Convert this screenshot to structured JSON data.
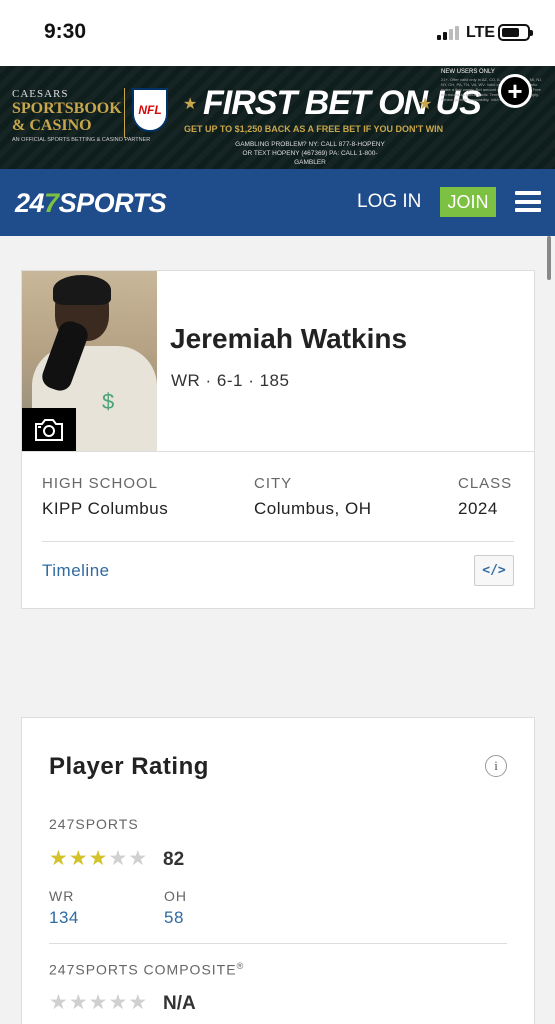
{
  "status_bar": {
    "time": "9:30",
    "network": "LTE"
  },
  "ad": {
    "brand_line1": "CAESARS",
    "brand_line2": "SPORTSBOOK",
    "brand_line3": "& CASINO",
    "brand_tagline": "AN OFFICIAL SPORTS BETTING & CASINO PARTNER",
    "nfl_logo": "NFL",
    "headline": "FIRST BET ON US",
    "subline": "GET UP TO $1,250 BACK AS A FREE BET IF YOU DON'T WIN",
    "gambling_line1": "GAMBLING PROBLEM? NY: CALL 877-8-HOPENY",
    "gambling_line2": "OR TEXT HOPENY (467369) PA: CALL 1-800-GAMBLER",
    "fineprint_title": "NEW USERS ONLY",
    "fineprint": "21+. Offer valid only in AZ, CO, IL, IN, IA, KS, LA, MI, NJ, NY, OH, PA, TN, VA, WV. Valid only for new users who make a first wager. Bet amount of qualifying wager. Free bet issued as bonus funds. Terms and conditions apply. Please gamble responsibly. Void where prohibited.",
    "close_icon": "plus-circle-icon"
  },
  "nav": {
    "logo_part1": "24",
    "logo_part2": "7",
    "logo_part3": "SPORTS",
    "login_label": "LOG IN",
    "join_label": "JOIN",
    "menu_icon": "hamburger-menu-icon",
    "brand_color": "#1f4c8a",
    "accent_color": "#7dc142"
  },
  "player": {
    "name": "Jeremiah Watkins",
    "meta": "WR · 6-1 · 185",
    "camera_icon": "camera-icon",
    "high_school_label": "HIGH SCHOOL",
    "high_school": "KIPP Columbus",
    "city_label": "CITY",
    "city": "Columbus, OH",
    "class_label": "CLASS",
    "class_year": "2024",
    "timeline_label": "Timeline",
    "embed_icon": "code-embed-icon",
    "embed_glyph": "</>"
  },
  "rating": {
    "title": "Player Rating",
    "info_icon": "info-icon",
    "info_glyph": "i",
    "section1_label": "247SPORTS",
    "section1_stars": 3,
    "section1_max_stars": 5,
    "section1_score": "82",
    "position_label": "WR",
    "position_rank": "134",
    "state_label": "OH",
    "state_rank": "58",
    "section2_label": "247SPORTS COMPOSITE",
    "section2_mark": "®",
    "section2_stars": 0,
    "section2_score": "N/A",
    "star_color": "#d4c22b"
  }
}
